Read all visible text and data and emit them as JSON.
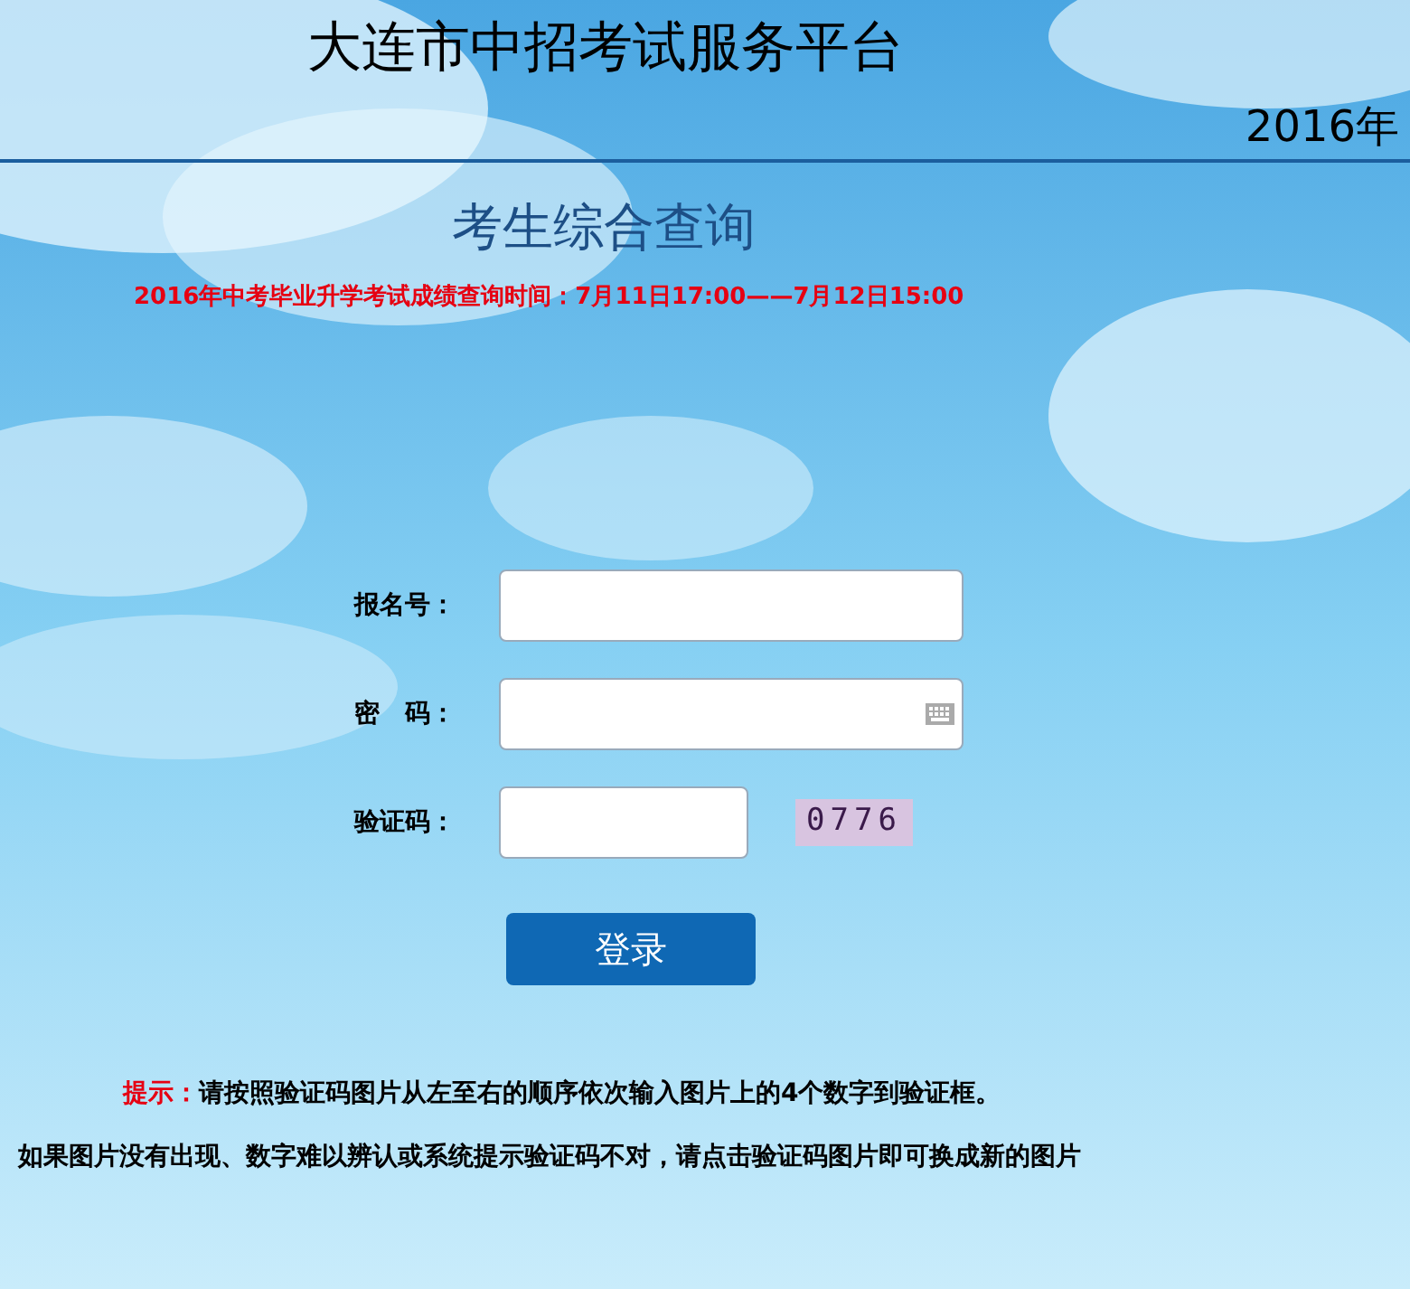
{
  "header": {
    "title": "大连市中招考试服务平台",
    "year": "2016年"
  },
  "page_title": "考生综合查询",
  "notice": "2016年中考毕业升学考试成绩查询时间：7月11日17:00——7月12日15:00",
  "form": {
    "fields": [
      {
        "label": "报名号：",
        "kind": "text"
      },
      {
        "label": "密　码：",
        "kind": "password"
      },
      {
        "label": "验证码：",
        "kind": "captcha",
        "captcha": "0776"
      }
    ],
    "submit": "登录"
  },
  "tip_label": "提示：",
  "tip_text": "请按照验证码图片从左至右的顺序依次输入图片上的4个数字到验证框。",
  "help_text": "如果图片没有出现、数字难以辨认或系统提示验证码不对，请点击验证码图片即可换成新的图片"
}
